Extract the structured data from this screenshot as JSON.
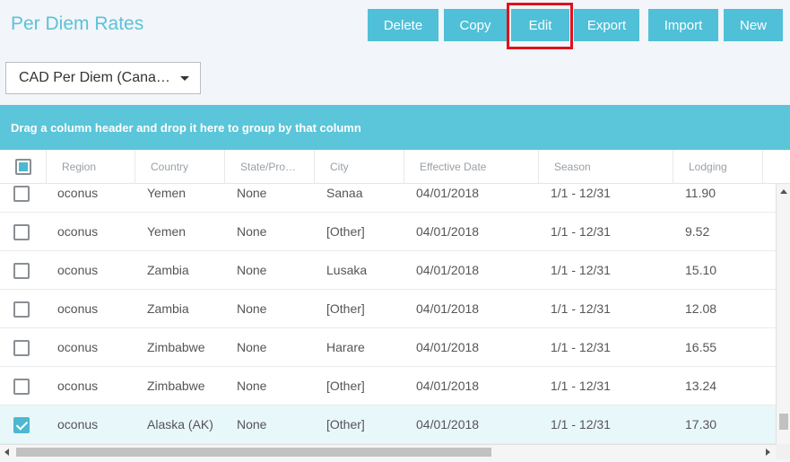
{
  "page": {
    "title": "Per Diem Rates"
  },
  "toolbar": {
    "delete_label": "Delete",
    "copy_label": "Copy",
    "edit_label": "Edit",
    "export_label": "Export",
    "import_label": "Import",
    "new_label": "New"
  },
  "filter": {
    "selected": "CAD Per Diem (Cana…"
  },
  "group_bar": {
    "text": "Drag a column header and drop it here to group by that column"
  },
  "columns": [
    "Region",
    "Country",
    "State/Pro…",
    "City",
    "Effective Date",
    "Season",
    "Lodging"
  ],
  "rows": [
    {
      "checked": false,
      "region": "oconus",
      "country": "Yemen",
      "state": "None",
      "city": "Sanaa",
      "effective": "04/01/2018",
      "season": "1/1 - 12/31",
      "lodging": "11.90"
    },
    {
      "checked": false,
      "region": "oconus",
      "country": "Yemen",
      "state": "None",
      "city": "[Other]",
      "effective": "04/01/2018",
      "season": "1/1 - 12/31",
      "lodging": "9.52"
    },
    {
      "checked": false,
      "region": "oconus",
      "country": "Zambia",
      "state": "None",
      "city": "Lusaka",
      "effective": "04/01/2018",
      "season": "1/1 - 12/31",
      "lodging": "15.10"
    },
    {
      "checked": false,
      "region": "oconus",
      "country": "Zambia",
      "state": "None",
      "city": "[Other]",
      "effective": "04/01/2018",
      "season": "1/1 - 12/31",
      "lodging": "12.08"
    },
    {
      "checked": false,
      "region": "oconus",
      "country": "Zimbabwe",
      "state": "None",
      "city": "Harare",
      "effective": "04/01/2018",
      "season": "1/1 - 12/31",
      "lodging": "16.55"
    },
    {
      "checked": false,
      "region": "oconus",
      "country": "Zimbabwe",
      "state": "None",
      "city": "[Other]",
      "effective": "04/01/2018",
      "season": "1/1 - 12/31",
      "lodging": "13.24"
    },
    {
      "checked": true,
      "region": "oconus",
      "country": "Alaska (AK)",
      "state": "None",
      "city": "[Other]",
      "effective": "04/01/2018",
      "season": "1/1 - 12/31",
      "lodging": "17.30"
    }
  ],
  "colors": {
    "accent": "#4fc0d7",
    "title": "#5bc2d9",
    "group_bar": "#5bc5d9",
    "highlight": "#e0121d"
  }
}
